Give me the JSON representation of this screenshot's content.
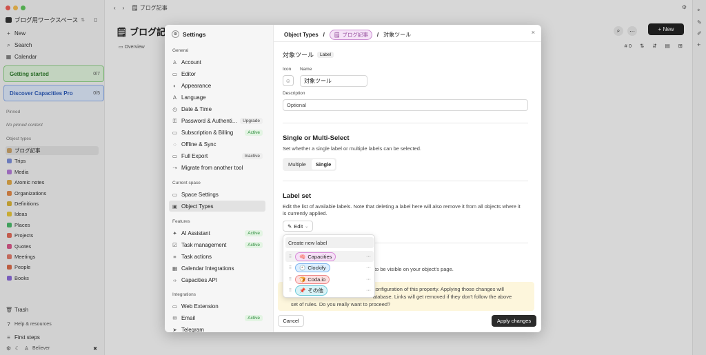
{
  "app": {
    "workspace": "ブログ用ワークスペース",
    "breadcrumb": "ブログ記事",
    "page_title": "ブログ記事",
    "new_button": "+ New",
    "tab_overview": "Overview",
    "count_label": "# 0"
  },
  "sidebar": {
    "new": "New",
    "search": "Search",
    "calendar": "Calendar",
    "getting_started": {
      "label": "Getting started",
      "count": "0/7"
    },
    "discover": {
      "label": "Discover Capacities Pro",
      "count": "0/5"
    },
    "pinned_header": "Pinned",
    "no_pinned": "No pinned content",
    "object_types_header": "Object types",
    "object_types": [
      {
        "label": "ブログ記事",
        "color": "#c9a26a"
      },
      {
        "label": "Trips",
        "color": "#7d8fd8"
      },
      {
        "label": "Media",
        "color": "#b27ad6"
      },
      {
        "label": "Atomic notes",
        "color": "#e0a94a"
      },
      {
        "label": "Organizations",
        "color": "#e08a4a"
      },
      {
        "label": "Definitions",
        "color": "#d8b23a"
      },
      {
        "label": "Ideas",
        "color": "#e6c53a"
      },
      {
        "label": "Places",
        "color": "#4ab86a"
      },
      {
        "label": "Projects",
        "color": "#e06a5a"
      },
      {
        "label": "Quotes",
        "color": "#d85a8a"
      },
      {
        "label": "Meetings",
        "color": "#e07a6a"
      },
      {
        "label": "People",
        "color": "#d86a4a"
      },
      {
        "label": "Books",
        "color": "#8a6ad8"
      }
    ],
    "trash": "Trash",
    "help": "Help & resources",
    "first_steps": "First steps",
    "user": "Believer"
  },
  "settings": {
    "title": "Settings",
    "general_header": "General",
    "general": [
      {
        "label": "Account",
        "icon": "user-icon",
        "badge": ""
      },
      {
        "label": "Editor",
        "icon": "editor-icon",
        "badge": ""
      },
      {
        "label": "Appearance",
        "icon": "appearance-icon",
        "badge": ""
      },
      {
        "label": "Language",
        "icon": "language-icon",
        "badge": ""
      },
      {
        "label": "Date & Time",
        "icon": "clock-icon",
        "badge": ""
      },
      {
        "label": "Password & Authenti...",
        "icon": "lock-icon",
        "badge": "Upgrade",
        "badge_type": "gray"
      },
      {
        "label": "Subscription & Billing",
        "icon": "card-icon",
        "badge": "Active",
        "badge_type": "active"
      },
      {
        "label": "Offline & Sync",
        "icon": "sync-icon",
        "badge": ""
      },
      {
        "label": "Full Export",
        "icon": "export-icon",
        "badge": "Inactive",
        "badge_type": "gray"
      },
      {
        "label": "Migrate from another tool",
        "icon": "migrate-icon",
        "badge": ""
      }
    ],
    "space_header": "Current space",
    "space": [
      {
        "label": "Space Settings",
        "icon": "monitor-icon",
        "badge": ""
      },
      {
        "label": "Object Types",
        "icon": "object-types-icon",
        "badge": "",
        "selected": true
      }
    ],
    "features_header": "Features",
    "features": [
      {
        "label": "AI Assistant",
        "icon": "ai-icon",
        "badge": "Active",
        "badge_type": "active"
      },
      {
        "label": "Task management",
        "icon": "task-icon",
        "badge": "Active",
        "badge_type": "active"
      },
      {
        "label": "Task actions",
        "icon": "task-actions-icon",
        "badge": ""
      },
      {
        "label": "Calendar Integrations",
        "icon": "calendar-icon",
        "badge": ""
      },
      {
        "label": "Capacities API",
        "icon": "api-icon",
        "badge": ""
      }
    ],
    "integrations_header": "Integrations",
    "integrations": [
      {
        "label": "Web Extension",
        "icon": "web-icon",
        "badge": ""
      },
      {
        "label": "Email",
        "icon": "email-icon",
        "badge": "Active",
        "badge_type": "active"
      },
      {
        "label": "Telegram",
        "icon": "telegram-icon",
        "badge": ""
      }
    ]
  },
  "content": {
    "crumb_root": "Object Types",
    "crumb_sep": "/",
    "crumb_object": "ブログ記事",
    "crumb_prop": "対象ツール",
    "prop_title": "対象ツール",
    "prop_type": "Label",
    "icon_label": "Icon",
    "name_label": "Name",
    "name_value": "対象ツール",
    "description_label": "Description",
    "description_placeholder": "Optional",
    "select_title": "Single or Multi-Select",
    "select_desc": "Set whether a single label or multiple labels can be selected.",
    "opt_multiple": "Multiple",
    "opt_single": "Single",
    "labelset_title": "Label set",
    "labelset_desc": "Edit the list of available labels. Note that deleting a label here will also remove it from all objects where it is currently applied.",
    "edit_button": "Edit",
    "hidden_text": "to be visible on your object's page.",
    "warning_text_1": "configuration of this property. Applying those changes will",
    "warning_text_2": "atabase. Links will get removed if they don't follow the above",
    "warning_text_3": "set of rules. Do you really want to proceed?",
    "cancel": "Cancel",
    "apply": "Apply changes"
  },
  "dropdown": {
    "create_placeholder": "Create new label",
    "labels": [
      {
        "text": "Capacities",
        "icon": "🧠",
        "bg": "#f6e1f7",
        "border": "#d88bd9"
      },
      {
        "text": "Clockify",
        "icon": "🕘",
        "bg": "#dcefff",
        "border": "#7bb4ee"
      },
      {
        "text": "Coda.io",
        "icon": "🍞",
        "bg": "#fde0e0",
        "border": "#ee8a8a"
      },
      {
        "text": "その他",
        "icon": "📌",
        "bg": "#d8f3f7",
        "border": "#6cc9d9"
      }
    ]
  }
}
